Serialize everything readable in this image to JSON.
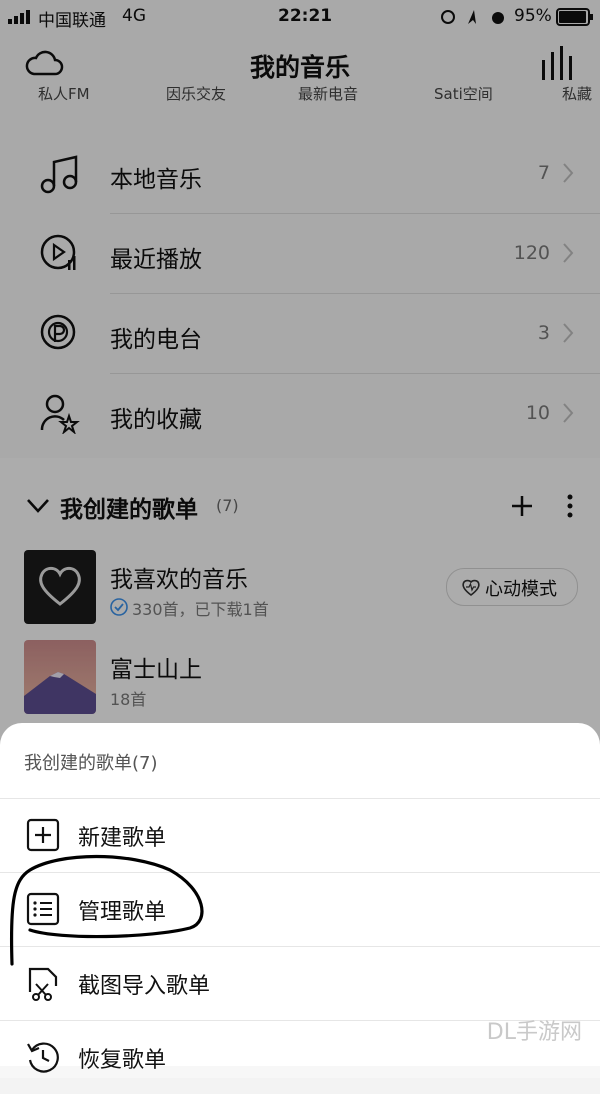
{
  "status_bar": {
    "carrier": "中国联通",
    "network": "4G",
    "time": "22:21",
    "battery": "95%"
  },
  "header": {
    "title": "我的音乐",
    "left_icon": "cloud-icon",
    "right_icon": "equalizer-icon"
  },
  "quick_links": [
    "私人FM",
    "因乐交友",
    "最新电音",
    "Sati空间",
    "私藏"
  ],
  "menu": [
    {
      "label": "本地音乐",
      "count": "7",
      "icon": "music-note-icon"
    },
    {
      "label": "最近播放",
      "count": "120",
      "icon": "recent-play-icon"
    },
    {
      "label": "我的电台",
      "count": "3",
      "icon": "radio-icon"
    },
    {
      "label": "我的收藏",
      "count": "10",
      "icon": "favorite-user-icon"
    }
  ],
  "section": {
    "title": "我创建的歌单",
    "count": "(7)"
  },
  "playlists": [
    {
      "name": "我喜欢的音乐",
      "meta": "330首，已下载1首",
      "mode_button": "心动模式"
    },
    {
      "name": "富士山上",
      "meta": "18首"
    }
  ],
  "sheet": {
    "header": "我创建的歌单(7)",
    "items": [
      {
        "label": "新建歌单",
        "icon": "plus-square-icon"
      },
      {
        "label": "管理歌单",
        "icon": "list-icon"
      },
      {
        "label": "截图导入歌单",
        "icon": "screenshot-import-icon"
      },
      {
        "label": "恢复歌单",
        "icon": "restore-icon"
      }
    ]
  },
  "watermark": "DL手游网"
}
